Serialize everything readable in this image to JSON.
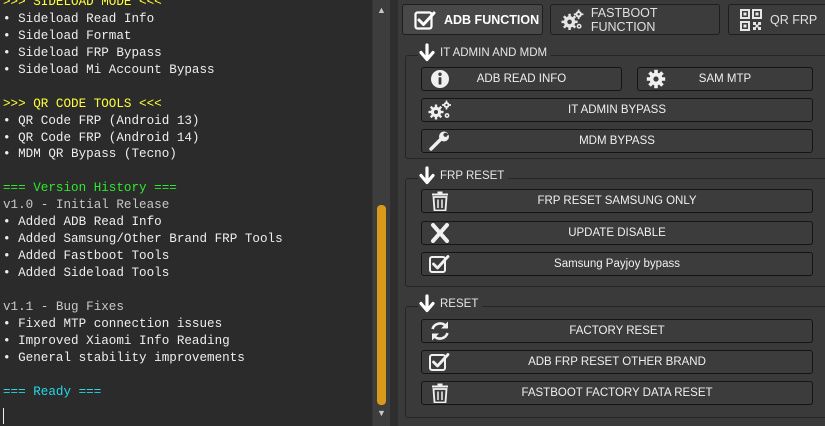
{
  "console": {
    "lines": [
      {
        "text": ">>> SIDELOAD MODE <<<",
        "color": "yellow"
      },
      {
        "text": "• Sideload Read Info",
        "color": "white"
      },
      {
        "text": "• Sideload Format",
        "color": "white"
      },
      {
        "text": "• Sideload FRP Bypass",
        "color": "white"
      },
      {
        "text": "• Sideload Mi Account Bypass",
        "color": "white"
      },
      {
        "text": "",
        "color": "white"
      },
      {
        "text": ">>> QR CODE TOOLS <<<",
        "color": "yellow"
      },
      {
        "text": "• QR Code FRP (Android 13)",
        "color": "white"
      },
      {
        "text": "• QR Code FRP (Android 14)",
        "color": "white"
      },
      {
        "text": "• MDM QR Bypass (Tecno)",
        "color": "white"
      },
      {
        "text": "",
        "color": "white"
      },
      {
        "text": "=== Version History ===",
        "color": "green"
      },
      {
        "text": "v1.0 - Initial Release",
        "color": "gray"
      },
      {
        "text": "• Added ADB Read Info",
        "color": "white"
      },
      {
        "text": "• Added Samsung/Other Brand FRP Tools",
        "color": "white"
      },
      {
        "text": "• Added Fastboot Tools",
        "color": "white"
      },
      {
        "text": "• Added Sideload Tools",
        "color": "white"
      },
      {
        "text": "",
        "color": "white"
      },
      {
        "text": "v1.1 - Bug Fixes",
        "color": "gray"
      },
      {
        "text": "• Fixed MTP connection issues",
        "color": "white"
      },
      {
        "text": "• Improved Xiaomi Info Reading",
        "color": "white"
      },
      {
        "text": "• General stability improvements",
        "color": "white"
      },
      {
        "text": "",
        "color": "white"
      },
      {
        "text": "=== Ready ===",
        "color": "cyan"
      }
    ]
  },
  "tabs": [
    {
      "label": "ADB FUNCTION",
      "icon": "checkbox-icon",
      "active": true
    },
    {
      "label": "FASTBOOT FUNCTION",
      "icon": "gears-icon",
      "active": false
    },
    {
      "label": "QR FRP",
      "icon": "qr-code-icon",
      "active": false
    }
  ],
  "sections": {
    "it_admin": {
      "title": "IT ADMIN AND MDM",
      "buttons": {
        "adb_read_info": "ADB READ INFO",
        "sam_mtp": "SAM MTP",
        "it_admin_bypass": "IT ADMIN BYPASS",
        "mdm_bypass": "MDM BYPASS"
      }
    },
    "frp_reset": {
      "title": "FRP RESET",
      "buttons": {
        "frp_reset_samsung": "FRP RESET SAMSUNG ONLY",
        "update_disable": "UPDATE DISABLE",
        "samsung_payjoy": "Samsung Payjoy bypass"
      }
    },
    "reset": {
      "title": "RESET",
      "buttons": {
        "factory_reset": "FACTORY RESET",
        "adb_frp_reset_other": "ADB FRP RESET OTHER BRAND",
        "fastboot_factory_reset": "FASTBOOT FACTORY DATA RESET"
      }
    }
  },
  "colors": {
    "console_bg": "#2b2b2b",
    "panel_bg": "#3a3a3a",
    "button_bg": "#3c3c3c",
    "scroll_thumb": "#d89a1a",
    "header_yellow": "#ffff3a",
    "header_green": "#2ee82e",
    "ready_cyan": "#22d8e8"
  }
}
